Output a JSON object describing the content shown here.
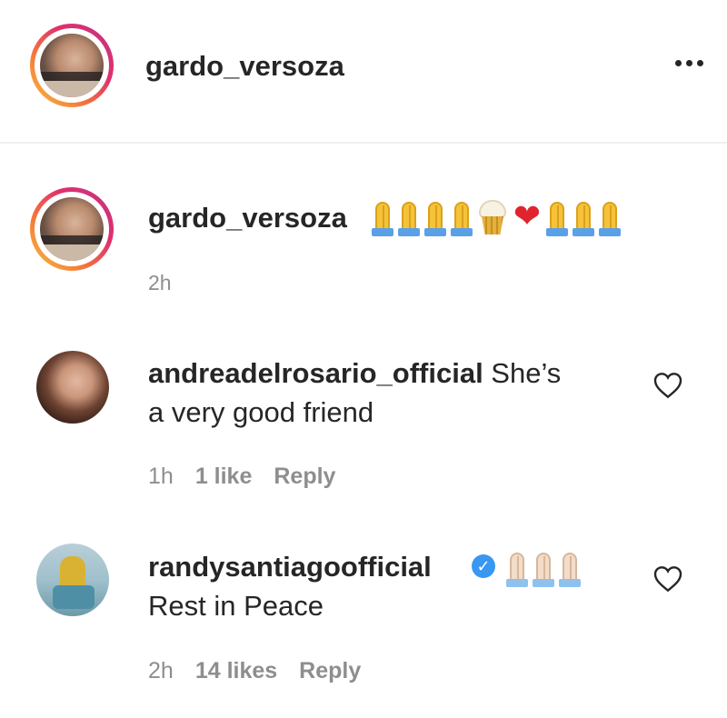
{
  "header": {
    "username": "gardo_versoza",
    "more_icon": "more-options-icon"
  },
  "caption": {
    "username": "gardo_versoza",
    "emojis": [
      "🙏",
      "🙏",
      "🙏",
      "🙏",
      "🧁",
      "❤️",
      "🙏",
      "🙏",
      "🙏"
    ],
    "time": "2h"
  },
  "comments": [
    {
      "username": "andreadelrosario_official",
      "text_line1": " She’s",
      "text_line2": "a very good friend",
      "time": "1h",
      "likes": "1 like",
      "reply": "Reply",
      "like_icon": "heart-outline-icon"
    },
    {
      "username": "randysantiagoofficial",
      "verified": true,
      "emojis": [
        "🙏",
        "🙏",
        "🙏"
      ],
      "text": "Rest in Peace",
      "time": "2h",
      "likes": "14 likes",
      "reply": "Reply",
      "like_icon": "heart-outline-icon"
    }
  ],
  "colors": {
    "text": "#262626",
    "secondary": "#8e8e8e",
    "divider": "#efefef",
    "verified": "#3897f0",
    "heart": "#e0242f"
  }
}
